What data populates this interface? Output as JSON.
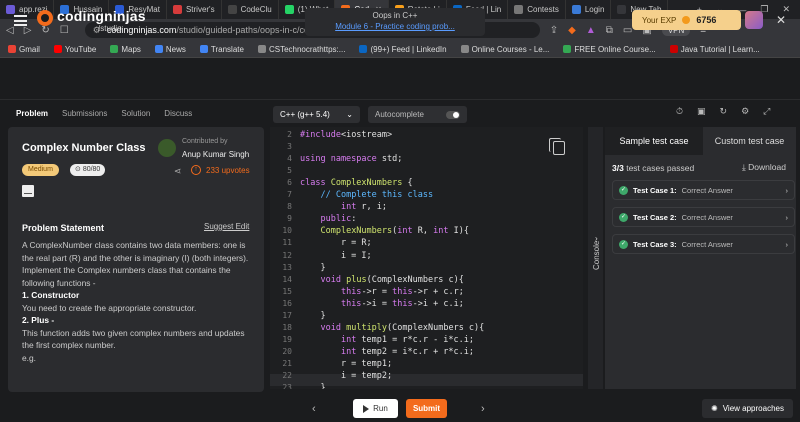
{
  "browser": {
    "tabs": [
      {
        "label": "app.rezi",
        "color": "#6b5bd6"
      },
      {
        "label": "Hussain",
        "color": "#2b6fd6"
      },
      {
        "label": "ResyMat",
        "color": "#2a5bd6"
      },
      {
        "label": "Striver's",
        "color": "#d63b3b"
      },
      {
        "label": "CodeClu",
        "color": "#444444"
      },
      {
        "label": "(1) What",
        "color": "#25d366"
      },
      {
        "label": "Cod",
        "color": "#f36b1c",
        "active": true
      },
      {
        "label": "Rotate Li",
        "color": "#f89f1b"
      },
      {
        "label": "Feed | Lin",
        "color": "#0a66c2"
      },
      {
        "label": "Contests",
        "color": "#777777"
      },
      {
        "label": "Login",
        "color": "#3a7ad6"
      },
      {
        "label": "New Tab",
        "color": "#35363a"
      }
    ],
    "url_domain": "codingninjas.com",
    "url_path": "/studio/guided-paths/oops-in-c/content/274160/offering/3757742?leftPanel...",
    "vpn_label": "VPN",
    "bookmarks": [
      {
        "label": "Gmail",
        "color": "#ea4335"
      },
      {
        "label": "YouTube",
        "color": "#ff0000"
      },
      {
        "label": "Maps",
        "color": "#34a853"
      },
      {
        "label": "News",
        "color": "#4285f4"
      },
      {
        "label": "Translate",
        "color": "#4285f4"
      },
      {
        "label": "CSTechnocrathttps:...",
        "color": "#888888"
      },
      {
        "label": "(99+) Feed | LinkedIn",
        "color": "#0a66c2"
      },
      {
        "label": "Online Courses - Le...",
        "color": "#888888"
      },
      {
        "label": "FREE Online Course...",
        "color": "#34a853"
      },
      {
        "label": "Java Tutorial | Learn...",
        "color": "#cc0000"
      }
    ]
  },
  "header": {
    "logo_text": "codingninjas",
    "logo_sub": "/studio",
    "course_title": "Oops in C++",
    "course_link": "Module 6 - Practice coding prob...",
    "exp_label": "Your EXP",
    "exp_value": "6756"
  },
  "left_tabs": [
    "Problem",
    "Submissions",
    "Solution",
    "Discuss"
  ],
  "problem": {
    "title": "Complex Number Class",
    "difficulty": "Medium",
    "score": "80/80",
    "contributed_label": "Contributed by",
    "contributor": "Anup Kumar Singh",
    "upvotes": "233 upvotes",
    "statement_heading": "Problem Statement",
    "suggest_edit": "Suggest Edit",
    "body": [
      {
        "text": "A ComplexNumber class contains two data members: one is the real part (R) and the other is imaginary (I) (both integers)."
      },
      {
        "text": "Implement the Complex numbers class that contains the following functions -"
      },
      {
        "text": "1. Constructor",
        "bold": true
      },
      {
        "text": "You need to create the appropriate constructor."
      },
      {
        "text": "2. Plus -",
        "bold": true
      },
      {
        "text": "This function adds two given complex numbers and updates the first complex number."
      },
      {
        "text": "e.g."
      }
    ]
  },
  "editor": {
    "language": "C++ (g++ 5.4)",
    "autocomplete_label": "Autocomplete",
    "lines": [
      {
        "n": "2",
        "html": "<span class='pp'>#include</span>&lt;iostream&gt;"
      },
      {
        "n": "3",
        "html": ""
      },
      {
        "n": "4",
        "html": "<span class='kw'>using namespace</span> std;"
      },
      {
        "n": "5",
        "html": ""
      },
      {
        "n": "6",
        "html": "<span class='kw'>class</span> <span class='fn'>ComplexNumbers</span> {"
      },
      {
        "n": "7",
        "html": "    <span class='cm'>// Complete this class</span>"
      },
      {
        "n": "8",
        "html": "        <span class='ty'>int</span> r, i;"
      },
      {
        "n": "9",
        "html": "    <span class='kw'>public</span>:"
      },
      {
        "n": "10",
        "html": "    <span class='fn'>ComplexNumbers</span>(<span class='ty'>int</span> R, <span class='ty'>int</span> I){"
      },
      {
        "n": "11",
        "html": "        r = R;"
      },
      {
        "n": "12",
        "html": "        i = I;"
      },
      {
        "n": "13",
        "html": "    }"
      },
      {
        "n": "14",
        "html": "    <span class='ty'>void</span> <span class='fn'>plus</span>(ComplexNumbers c){"
      },
      {
        "n": "15",
        "html": "        <span class='kw'>this</span>-&gt;r = <span class='kw'>this</span>-&gt;r + c.r;"
      },
      {
        "n": "16",
        "html": "        <span class='kw'>this</span>-&gt;i = <span class='kw'>this</span>-&gt;i + c.i;"
      },
      {
        "n": "17",
        "html": "    }"
      },
      {
        "n": "18",
        "html": "    <span class='ty'>void</span> <span class='fn'>multiply</span>(ComplexNumbers c){"
      },
      {
        "n": "19",
        "html": "        <span class='ty'>int</span> temp1 = r*c.r - i*c.i;"
      },
      {
        "n": "20",
        "html": "        <span class='ty'>int</span> temp2 = i*c.r + r*c.i;"
      },
      {
        "n": "21",
        "html": "        r = temp1;"
      },
      {
        "n": "22",
        "html": "        i = temp2;"
      },
      {
        "n": "23",
        "html": "    }"
      }
    ]
  },
  "console_label": "Console",
  "tests": {
    "tab_sample": "Sample test case",
    "tab_custom": "Custom test case",
    "passed_count": "3/3",
    "passed_text": "test cases passed",
    "download": "Download",
    "cases": [
      {
        "name": "Test Case 1:",
        "result": "Correct Answer"
      },
      {
        "name": "Test Case 2:",
        "result": "Correct Answer"
      },
      {
        "name": "Test Case 3:",
        "result": "Correct Answer"
      }
    ]
  },
  "footer": {
    "run": "Run",
    "submit": "Submit",
    "view_approaches": "View approaches"
  }
}
